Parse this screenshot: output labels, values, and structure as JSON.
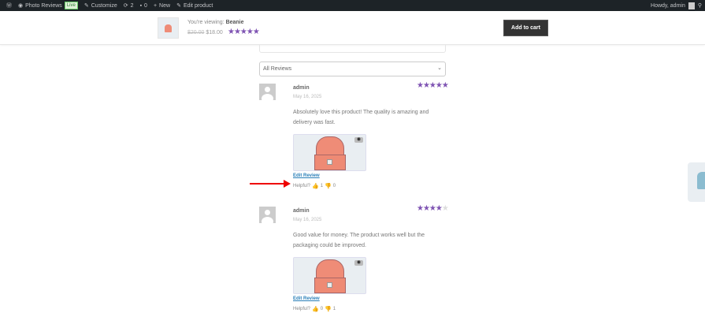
{
  "adminbar": {
    "site": "Photo Reviews",
    "live": "Live",
    "customize": "Customize",
    "updates": "2",
    "comments": "0",
    "new": "New",
    "edit": "Edit product",
    "howdy": "Howdy, admin"
  },
  "sticky": {
    "viewing_prefix": "You're viewing:",
    "product": "Beanie",
    "old_price": "$20.00",
    "price": "$18.00",
    "stars": "★★★★★",
    "add_to_cart": "Add to cart"
  },
  "filter": {
    "selected": "All Reviews"
  },
  "reviews": [
    {
      "author": "admin",
      "date": "May 16, 2025",
      "rating": 5,
      "stars_on": "★★★★★",
      "stars_off": "",
      "text": "Absolutely love this product! The quality is amazing and delivery was fast.",
      "edit": "Edit Review",
      "helpful": "Helpful?",
      "up": "1",
      "down": "0"
    },
    {
      "author": "admin",
      "date": "May 16, 2025",
      "rating": 4,
      "stars_on": "★★★★",
      "stars_off": "★",
      "text": "Good value for money. The product works well but the packaging could be improved.",
      "edit": "Edit Review",
      "helpful": "Helpful?",
      "up": "0",
      "down": "1"
    }
  ]
}
